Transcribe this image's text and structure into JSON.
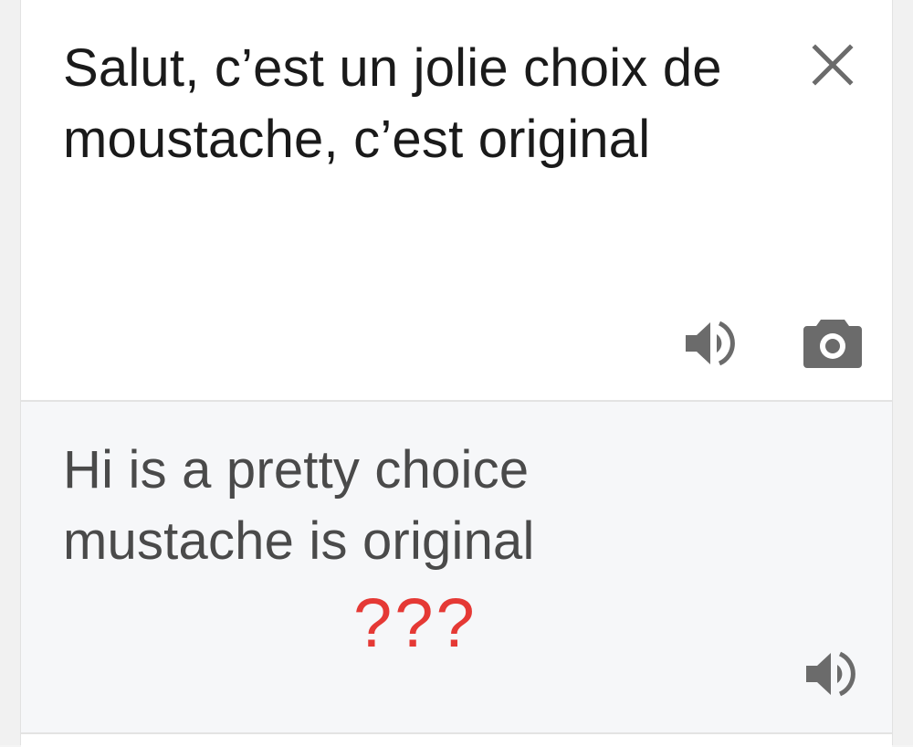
{
  "source": {
    "text": "Salut, c’est un jolie choix de moustache, c’est original",
    "close_icon": "close-icon",
    "speaker_icon": "speaker-icon",
    "camera_icon": "camera-icon"
  },
  "translation": {
    "text": "Hi is a pretty choice mustache is original",
    "annotation": "???",
    "annotation_color": "#e53935",
    "speaker_icon": "speaker-icon"
  },
  "colors": {
    "icon": "#6b6b6b",
    "source_bg": "#ffffff",
    "translation_bg": "#f6f7f9"
  }
}
